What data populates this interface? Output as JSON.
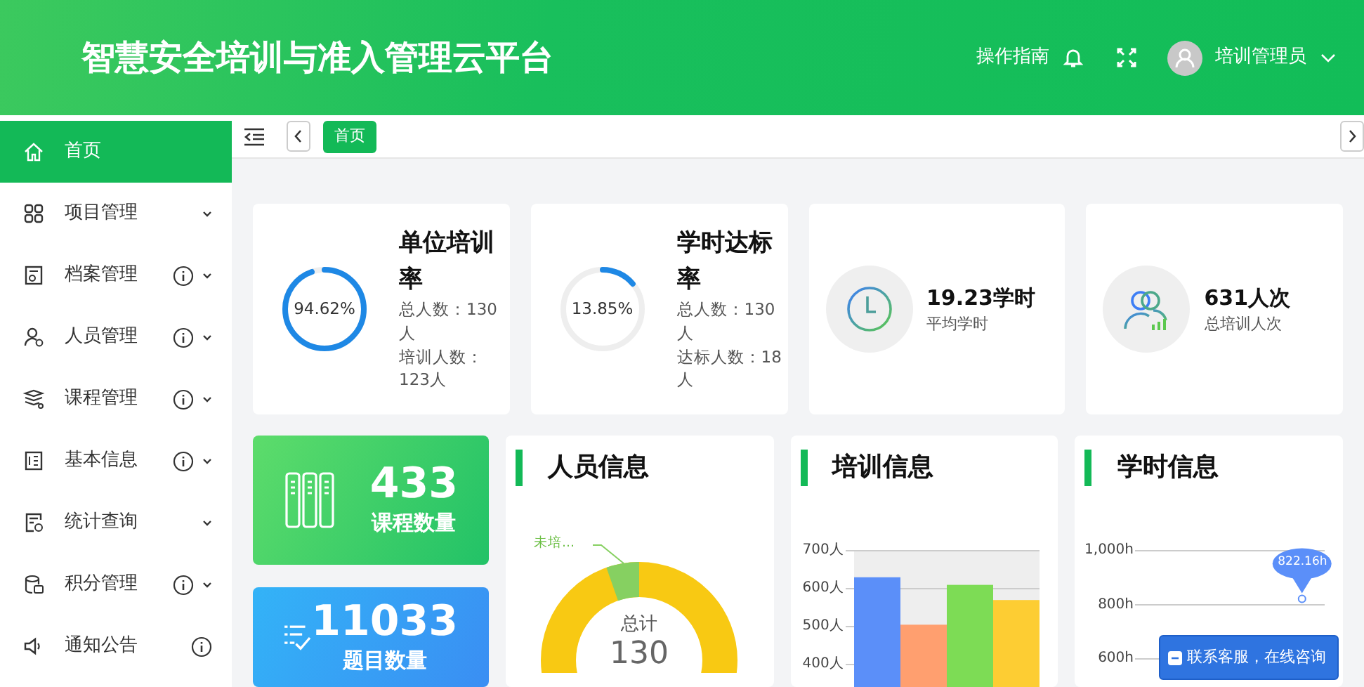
{
  "header": {
    "title": "智慧安全培训与准入管理云平台",
    "guide": "操作指南",
    "user": "培训管理员"
  },
  "sidebar": {
    "items": [
      {
        "label": "首页",
        "selected": true,
        "info": false,
        "expandable": false
      },
      {
        "label": "项目管理",
        "selected": false,
        "info": false,
        "expandable": true
      },
      {
        "label": "档案管理",
        "selected": false,
        "info": true,
        "expandable": true
      },
      {
        "label": "人员管理",
        "selected": false,
        "info": true,
        "expandable": true
      },
      {
        "label": "课程管理",
        "selected": false,
        "info": true,
        "expandable": true
      },
      {
        "label": "基本信息",
        "selected": false,
        "info": true,
        "expandable": true
      },
      {
        "label": "统计查询",
        "selected": false,
        "info": false,
        "expandable": true
      },
      {
        "label": "积分管理",
        "selected": false,
        "info": true,
        "expandable": true
      },
      {
        "label": "通知公告",
        "selected": false,
        "info": true,
        "expandable": false
      }
    ]
  },
  "tabs": [
    {
      "label": "首页",
      "selected": true
    }
  ],
  "stats": [
    {
      "kind": "ring",
      "title": "单位培训率",
      "level": 0.9462,
      "percent": "94.62%",
      "lines": [
        "总人数：130人",
        "培训人数：123人"
      ]
    },
    {
      "kind": "ring",
      "title": "学时达标率",
      "level": 0.1385,
      "percent": "13.85%",
      "lines": [
        "总人数：130人",
        "达标人数：18人"
      ]
    },
    {
      "kind": "clock",
      "value": "19.23学时",
      "caption": "平均学时"
    },
    {
      "kind": "people",
      "value": "631人次",
      "caption": "总培训人次"
    }
  ],
  "tiles": [
    {
      "kind": "courses",
      "value": "433",
      "caption": "课程数量"
    },
    {
      "kind": "questions",
      "value": "11033",
      "caption": "题目数量"
    }
  ],
  "panels": [
    {
      "kind": "donut",
      "title": "人员信息",
      "slice_label": "未培...",
      "center_label": "总计",
      "center_value": "130"
    },
    {
      "kind": "bar",
      "title": "培训信息",
      "chart_data": {
        "type": "bar",
        "ylim": [
          400,
          700
        ],
        "yticks": [
          {
            "value": 400,
            "label": "400人"
          },
          {
            "value": 500,
            "label": "500人"
          },
          {
            "value": 600,
            "label": "600人"
          },
          {
            "value": 700,
            "label": "700人"
          }
        ],
        "series": [
          {
            "color": "#5b8ff9",
            "values": [
              630
            ]
          },
          {
            "color": "#ff9f6f",
            "values": [
              505
            ]
          },
          {
            "color": "#7ddc55",
            "values": [
              610
            ]
          },
          {
            "color": "#fdcd33",
            "values": [
              570
            ]
          }
        ]
      }
    },
    {
      "kind": "line",
      "title": "学时信息",
      "chart_data": {
        "type": "line",
        "ylim": [
          600,
          1000
        ],
        "yticks": [
          {
            "value": 600,
            "label": "600h"
          },
          {
            "value": 800,
            "label": "800h"
          },
          {
            "value": 1000,
            "label": "1,000h"
          }
        ],
        "series": [
          {
            "color": "#5b8ff9",
            "marker": "circle",
            "values": [
              null,
              null,
              null,
              822
            ]
          }
        ],
        "annotations": [
          "822.16h"
        ]
      }
    }
  ],
  "support_button": "联系客服，在线咨询"
}
